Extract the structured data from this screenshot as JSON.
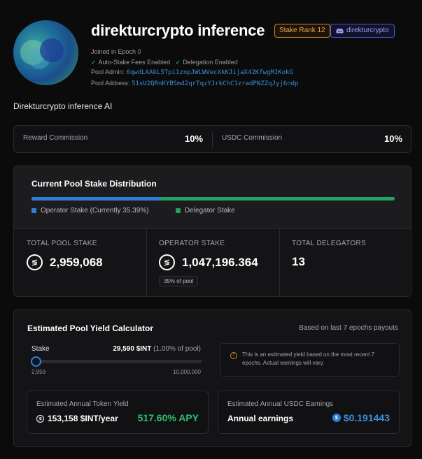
{
  "header": {
    "title": "direkturcrypto inference",
    "rank_badge": "Stake Rank 12",
    "discord_handle": "direkturcrypto",
    "joined": "Joined in Epoch 0",
    "auto_stake": "Auto-Stake Fees Enabled",
    "delegation": "Delegation Enabled",
    "pool_admin_label": "Pool Admin:",
    "pool_admin": "6qwdLAAkL5Tpi1znpJWLWVecXkKJijaX42KfwgMJKokG",
    "pool_address_label": "Pool Address:",
    "pool_address": "51sU2QRnKYBSm42qrTqzYJrkChC1zradPNZZqJyj6ndp"
  },
  "description": "Direkturcrypto inference AI",
  "commission": {
    "reward_label": "Reward Commission",
    "reward_value": "10%",
    "usdc_label": "USDC Commission",
    "usdc_value": "10%"
  },
  "distribution": {
    "title": "Current Pool Stake Distribution",
    "operator_fraction": 0.3539,
    "operator_color": "#2f7fd8",
    "delegator_color": "#21a262",
    "operator_legend": "Operator Stake (Currently 35.39%)",
    "delegator_legend": "Delegator Stake",
    "total_pool_stake_label": "TOTAL POOL STAKE",
    "total_pool_stake": "2,959,068",
    "operator_stake_label": "OPERATOR STAKE",
    "operator_stake": "1,047,196.364",
    "operator_pct_tag": "35% of pool",
    "total_delegators_label": "TOTAL DELEGATORS",
    "total_delegators": "13"
  },
  "yield": {
    "title": "Estimated Pool Yield Calculator",
    "note": "Based on last 7 epochs payouts",
    "stake_label": "Stake",
    "stake_value": "29,590 $INT",
    "stake_pct": "(1.00% of pool)",
    "slider_min": "2,959",
    "slider_max": "10,000,000",
    "slider_value_fraction": 0.00296,
    "info_text": "This is an estimated yield based on the most recent 7 epochs. Actual earnings will vary.",
    "token_yield_label": "Estimated Annual Token Yield",
    "token_yield": "153,158 $INT/year",
    "apy": "517.60% APY",
    "usdc_label": "Estimated Annual USDC Earnings",
    "usdc_sub": "Annual earnings",
    "usdc_value": "$0.191443"
  }
}
